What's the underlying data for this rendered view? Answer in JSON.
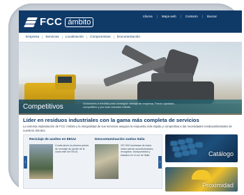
{
  "header": {
    "logo_text": "FCC",
    "logo_sub": "ámbito",
    "links": [
      "Idioma",
      "Mapa web",
      "Contacto",
      "Buscar"
    ]
  },
  "nav": {
    "items": [
      "Empresa",
      "Servicios",
      "Localización",
      "Compromisos",
      "Documentación"
    ]
  },
  "hero": {
    "title": "Competitivos",
    "description": "Soluciones a medida para conseguir ventaja de empresa. Precio ajustado, competitivo y por todo volumen infinito."
  },
  "main": {
    "headline": "Líder en residuos industriales con la gama más completa de servicios",
    "intro": "La extensa implantación de FCC Ámbito y la integralidad de sus servicios asegura la respuesta más rápida y competitiva a las necesidades medioambientales de nuestros clientes."
  },
  "news": {
    "items": [
      {
        "title": "Reciclaje de aceites en EEUU",
        "text": "Construimos la primera planta de reciclaje de aceite de la costa este de EEUU."
      },
      {
        "title": "Descontaminación suelos Italia",
        "text": "257.000 toneladas de lodos están siendo acondicionados, recogidos, transportados y tratados en el sur de Italia."
      }
    ],
    "arrow_left": "‹",
    "arrow_right": "›"
  },
  "tiles": {
    "catalogo": "Catálogo",
    "proximidad": "Proximidad"
  },
  "colors": {
    "brand": "#0f3a68",
    "accent": "#2a5f95"
  }
}
